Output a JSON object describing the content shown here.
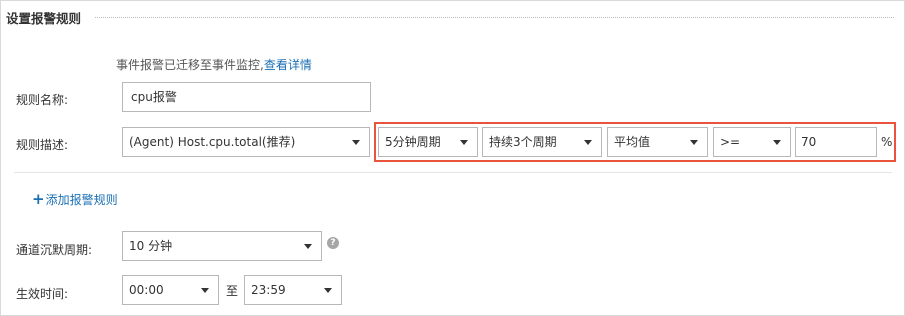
{
  "section": {
    "title": "设置报警规则"
  },
  "notice": {
    "text": "事件报警已迁移至事件监控,",
    "link": "查看详情"
  },
  "rule_name": {
    "label": "规则名称:",
    "value": "cpu报警"
  },
  "rule_desc": {
    "label": "规则描述:",
    "metric": "(Agent) Host.cpu.total(推荐)",
    "period": "5分钟周期",
    "duration": "持续3个周期",
    "statistic": "平均值",
    "operator": ">=",
    "threshold": "70",
    "unit": "%"
  },
  "add_rule": {
    "label": "添加报警规则",
    "icon": "plus-icon"
  },
  "silence": {
    "label": "通道沉默周期:",
    "value": "10 分钟",
    "help_icon": "help-icon",
    "help_glyph": "?"
  },
  "effective_time": {
    "label": "生效时间:",
    "start": "00:00",
    "to": "至",
    "end": "23:59"
  },
  "colors": {
    "accent": "#1a6fb4",
    "highlight_border": "#e8553c"
  }
}
